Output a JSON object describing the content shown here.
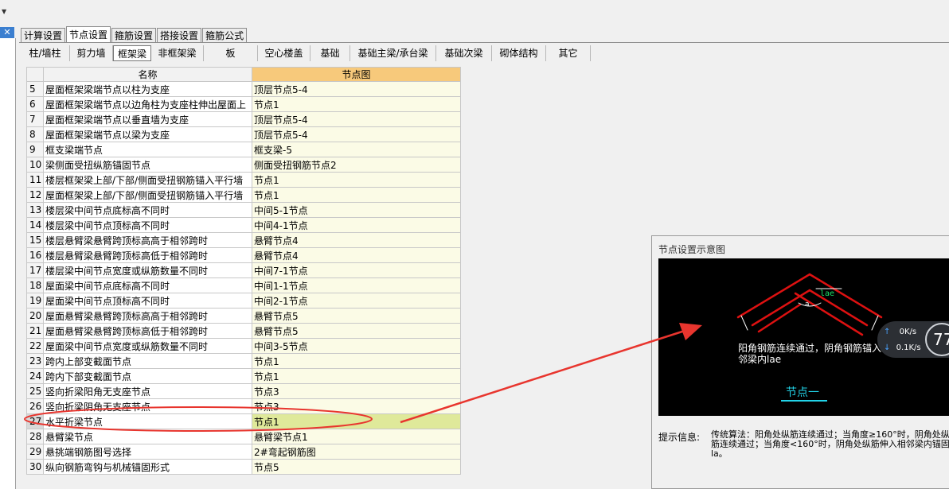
{
  "main_tabs": [
    "计算设置",
    "节点设置",
    "箍筋设置",
    "搭接设置",
    "箍筋公式"
  ],
  "active_main_tab": 1,
  "sub_tabs": [
    "柱/墙柱",
    "剪力墙",
    "框架梁",
    "非框架梁",
    "板",
    "空心楼盖",
    "基础",
    "基础主梁/承台梁",
    "基础次梁",
    "砌体结构",
    "其它"
  ],
  "active_sub_tab": 2,
  "table": {
    "headers": [
      "名称",
      "节点图"
    ],
    "rows": [
      {
        "no": "5",
        "name": "屋面框架梁端节点以柱为支座",
        "value": "顶层节点5-4"
      },
      {
        "no": "6",
        "name": "屋面框架梁端节点以边角柱为支座柱伸出屋面上",
        "value": "节点1"
      },
      {
        "no": "7",
        "name": "屋面框架梁端节点以垂直墙为支座",
        "value": "顶层节点5-4"
      },
      {
        "no": "8",
        "name": "屋面框架梁端节点以梁为支座",
        "value": "顶层节点5-4"
      },
      {
        "no": "9",
        "name": "框支梁端节点",
        "value": "框支梁-5"
      },
      {
        "no": "10",
        "name": "梁侧面受扭纵筋锚固节点",
        "value": "侧面受扭钢筋节点2"
      },
      {
        "no": "11",
        "name": "楼层框架梁上部/下部/侧面受扭钢筋锚入平行墙",
        "value": "节点1"
      },
      {
        "no": "12",
        "name": "屋面框架梁上部/下部/侧面受扭钢筋锚入平行墙",
        "value": "节点1"
      },
      {
        "no": "13",
        "name": "楼层梁中间节点底标高不同时",
        "value": "中间5-1节点"
      },
      {
        "no": "14",
        "name": "楼层梁中间节点顶标高不同时",
        "value": "中间4-1节点"
      },
      {
        "no": "15",
        "name": "楼层悬臂梁悬臂跨顶标高高于相邻跨时",
        "value": "悬臂节点4"
      },
      {
        "no": "16",
        "name": "楼层悬臂梁悬臂跨顶标高低于相邻跨时",
        "value": "悬臂节点4"
      },
      {
        "no": "17",
        "name": "楼层梁中间节点宽度或纵筋数量不同时",
        "value": "中间7-1节点"
      },
      {
        "no": "18",
        "name": "屋面梁中间节点底标高不同时",
        "value": "中间1-1节点"
      },
      {
        "no": "19",
        "name": "屋面梁中间节点顶标高不同时",
        "value": "中间2-1节点"
      },
      {
        "no": "20",
        "name": "屋面悬臂梁悬臂跨顶标高高于相邻跨时",
        "value": "悬臂节点5"
      },
      {
        "no": "21",
        "name": "屋面悬臂梁悬臂跨顶标高低于相邻跨时",
        "value": "悬臂节点5"
      },
      {
        "no": "22",
        "name": "屋面梁中间节点宽度或纵筋数量不同时",
        "value": "中间3-5节点"
      },
      {
        "no": "23",
        "name": "跨内上部变截面节点",
        "value": "节点1"
      },
      {
        "no": "24",
        "name": "跨内下部变截面节点",
        "value": "节点1"
      },
      {
        "no": "25",
        "name": "竖向折梁阳角无支座节点",
        "value": "节点3"
      },
      {
        "no": "26",
        "name": "竖向折梁阴角无支座节点",
        "value": "节点3"
      },
      {
        "no": "27",
        "name": "水平折梁节点",
        "value": "节点1"
      },
      {
        "no": "28",
        "name": "悬臂梁节点",
        "value": "悬臂梁节点1"
      },
      {
        "no": "29",
        "name": "悬挑端钢筋图号选择",
        "value": "2#弯起钢筋图"
      },
      {
        "no": "30",
        "name": "纵向钢筋弯钩与机械锚固形式",
        "value": "节点5"
      }
    ],
    "selected_row": 22
  },
  "preview": {
    "title": "节点设置示意图",
    "dim_label": "lae",
    "angle_label": "a",
    "caption": "阳角钢筋连续通过，阴角钢筋锚入相邻梁内lae",
    "node_label": "节点一",
    "hint_label": "提示信息:",
    "hint_text": "传统算法：阳角处纵筋连续通过；当角度≥160°时，阴角处纵筋连续通过；当角度<160°时，阴角处纵筋伸入相邻梁内锚固la。"
  },
  "network_widget": {
    "up": "0K/s",
    "down": "0.1K/s",
    "gauge": "77"
  },
  "colors": {
    "annotation_red": "#e8352e",
    "header_highlight": "#f7c97b",
    "selected_row": "#dfe99a",
    "node_label": "#22d3e8"
  },
  "icons": {
    "close": "close-icon",
    "dropdown": "chevron-down-icon",
    "upload": "upload-arrow-icon",
    "download": "download-arrow-icon"
  }
}
